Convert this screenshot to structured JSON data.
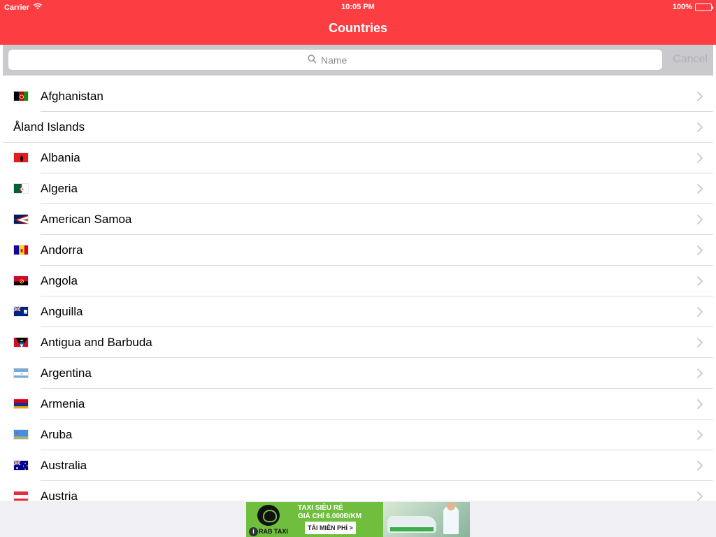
{
  "status_bar": {
    "carrier": "Carrier",
    "time": "10:05 PM",
    "battery": "100%"
  },
  "nav": {
    "title": "Countries"
  },
  "search": {
    "placeholder": "Name",
    "cancel_label": "Cancel"
  },
  "countries": [
    {
      "name": "Afghanistan",
      "flag": "af",
      "has_flag": true
    },
    {
      "name": "Åland Islands",
      "flag": "",
      "has_flag": false
    },
    {
      "name": "Albania",
      "flag": "al",
      "has_flag": true
    },
    {
      "name": "Algeria",
      "flag": "dz",
      "has_flag": true
    },
    {
      "name": "American Samoa",
      "flag": "as",
      "has_flag": true
    },
    {
      "name": "Andorra",
      "flag": "ad",
      "has_flag": true
    },
    {
      "name": "Angola",
      "flag": "ao",
      "has_flag": true
    },
    {
      "name": "Anguilla",
      "flag": "ai",
      "has_flag": true
    },
    {
      "name": "Antigua and Barbuda",
      "flag": "ag",
      "has_flag": true
    },
    {
      "name": "Argentina",
      "flag": "ar",
      "has_flag": true
    },
    {
      "name": "Armenia",
      "flag": "am",
      "has_flag": true
    },
    {
      "name": "Aruba",
      "flag": "aw",
      "has_flag": true
    },
    {
      "name": "Australia",
      "flag": "au",
      "has_flag": true
    },
    {
      "name": "Austria",
      "flag": "at",
      "has_flag": true
    }
  ],
  "ad": {
    "line1": "TAXI SIÊU RẺ",
    "line2": "GIÁ CHỈ 6.000Đ/KM",
    "cta": "TẢI MIỄN PHÍ >",
    "brand": "RAB TAXI",
    "info_symbol": "i"
  },
  "colors": {
    "accent": "#fc3d42",
    "search_bar_bg": "#c9c9ce",
    "separator": "#d9d9d9",
    "chevron": "#c7c7cc",
    "ad_green": "#6fbe3e"
  }
}
